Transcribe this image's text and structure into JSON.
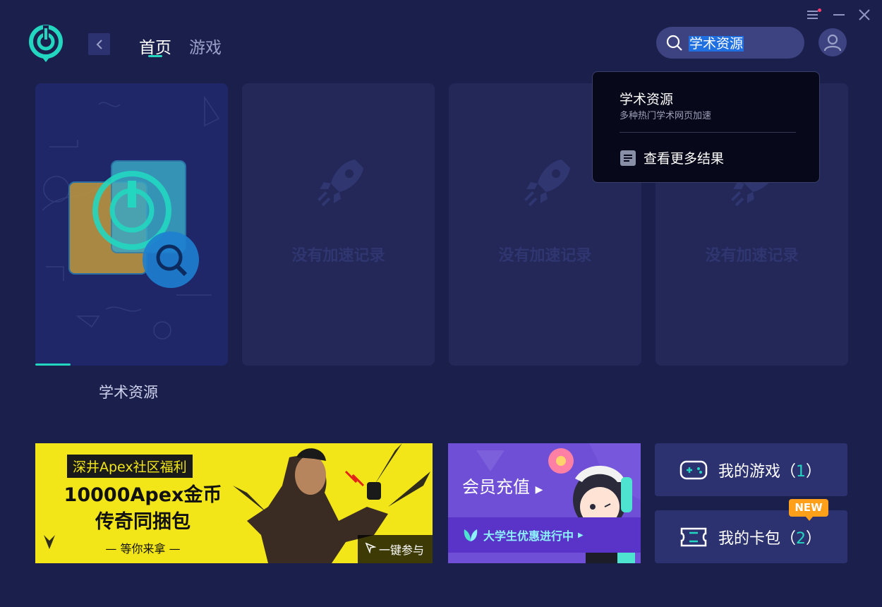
{
  "header": {
    "tabs": [
      {
        "label": "首页",
        "active": true
      },
      {
        "label": "游戏",
        "active": false
      }
    ],
    "search_value": "学术资源"
  },
  "dropdown": {
    "result_title": "学术资源",
    "result_desc": "多种热门学术网页加速",
    "more_label": "查看更多结果"
  },
  "cards": [
    {
      "label": "学术资源"
    },
    {
      "empty_text": "没有加速记录"
    },
    {
      "empty_text": "没有加速记录"
    },
    {
      "empty_text": "没有加速记录"
    }
  ],
  "banners": {
    "apex": {
      "tag": "深井Apex社区福利",
      "line1": "10000Apex金币",
      "line2": "传奇同捆包",
      "sub": "— 等你来拿 —",
      "cta": "一键参与"
    },
    "vip": {
      "title": "会员充值",
      "strip": "大学生优惠进行中"
    }
  },
  "side": {
    "my_games_label": "我的游戏（",
    "my_games_count": "1",
    "my_games_close": "）",
    "my_cards_label": "我的卡包（",
    "my_cards_count": "2",
    "my_cards_close": "）",
    "new_badge": "NEW"
  },
  "colors": {
    "background": "#1b1f4b",
    "accent": "#22d6c0",
    "card": "#232858",
    "button": "#2c3270"
  }
}
